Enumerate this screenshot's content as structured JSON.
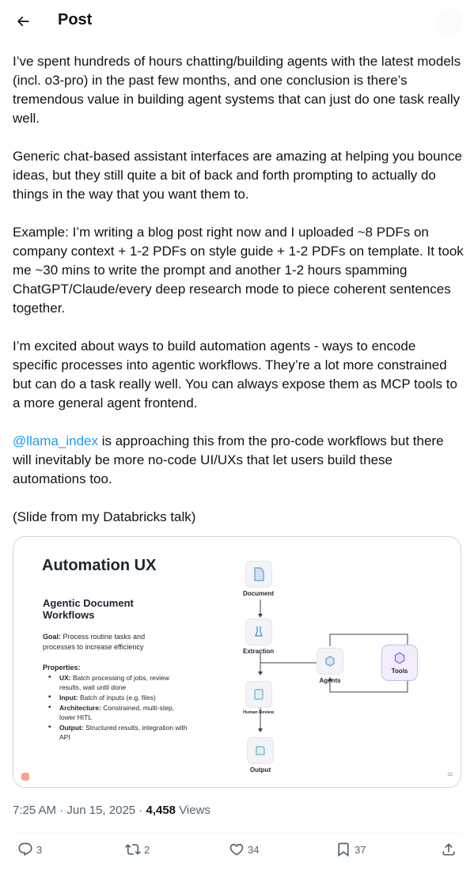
{
  "header": {
    "title": "Post",
    "back_icon": "arrow-left-icon"
  },
  "post": {
    "paragraphs": [
      "I’ve spent hundreds of hours chatting/building agents with the latest models (incl. o3-pro) in the past few months, and one conclusion is there’s tremendous value in building agent systems that can just do one task really well.",
      "Generic chat-based assistant interfaces are amazing at helping you bounce ideas, but they still quite a bit of back and forth prompting to actually do things in the way that you want them to.",
      "Example: I’m writing a blog post right now and I uploaded ~8 PDFs on company context + 1-2 PDFs on style guide + 1-2 PDFs on template. It took me ~30 mins to write the prompt and another 1-2 hours spamming ChatGPT/Claude/every deep research mode to piece coherent sentences together.",
      "I’m excited about ways to build automation agents - ways to encode specific processes into agentic workflows. They’re a lot more constrained but can do a task really well. You can always expose them as MCP tools to a more general agent frontend."
    ],
    "mention": "@llama_index",
    "mention_rest": " is approaching this from the pro-code workflows but there will inevitably be more no-code UI/UXs that let users build these automations too.",
    "closing": "(Slide from my Databricks talk)"
  },
  "slide": {
    "title": "Automation UX",
    "subtitle": "Agentic Document Workflows",
    "goal_label": "Goal:",
    "goal_text": " Process routine tasks and processes to increase efficiency",
    "properties_label": "Properties:",
    "properties": [
      {
        "key": "UX:",
        "text": " Batch processing of jobs, review results, wait until done"
      },
      {
        "key": "Input:",
        "text": " Batch of inputs (e.g. files)"
      },
      {
        "key": "Architecture:",
        "text": " Constrained, multi-step, lower HITL"
      },
      {
        "key": "Output:",
        "text": " Structured results, integration with API"
      }
    ],
    "nodes": {
      "document": "Document",
      "extraction": "Extraction",
      "human_review": "Human Review",
      "output": "Output",
      "agents": "Agents",
      "tools": "Tools"
    },
    "page_number": "32",
    "accent_color": "#c9b6f2"
  },
  "meta": {
    "time": "7:25 AM",
    "separator": " · ",
    "date": "Jun 15, 2025",
    "views_count": "4,458",
    "views_label": " Views"
  },
  "actions": {
    "replies": "3",
    "reposts": "2",
    "likes": "34",
    "bookmarks": "37"
  }
}
